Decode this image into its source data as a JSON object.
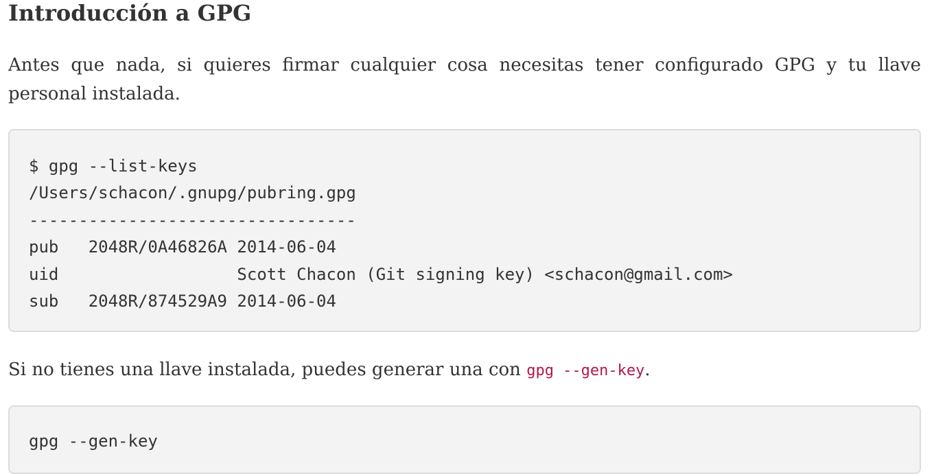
{
  "section": {
    "title": "Introducción a GPG"
  },
  "intro": {
    "text": "Antes que nada, si quieres firmar cualquier cosa necesitas tener configurado GPG y tu llave personal instalada."
  },
  "code_list_keys": {
    "content": "$ gpg --list-keys\n/Users/schacon/.gnupg/pubring.gpg\n---------------------------------\npub   2048R/0A46826A 2014-06-04\nuid                  Scott Chacon (Git signing key) <schacon@gmail.com>\nsub   2048R/874529A9 2014-06-04"
  },
  "gen_key_text": {
    "before": "Si no tienes una llave instalada, puedes generar una con ",
    "code": "gpg --gen-key",
    "after": "."
  },
  "code_gen_key": {
    "content": "gpg --gen-key"
  }
}
